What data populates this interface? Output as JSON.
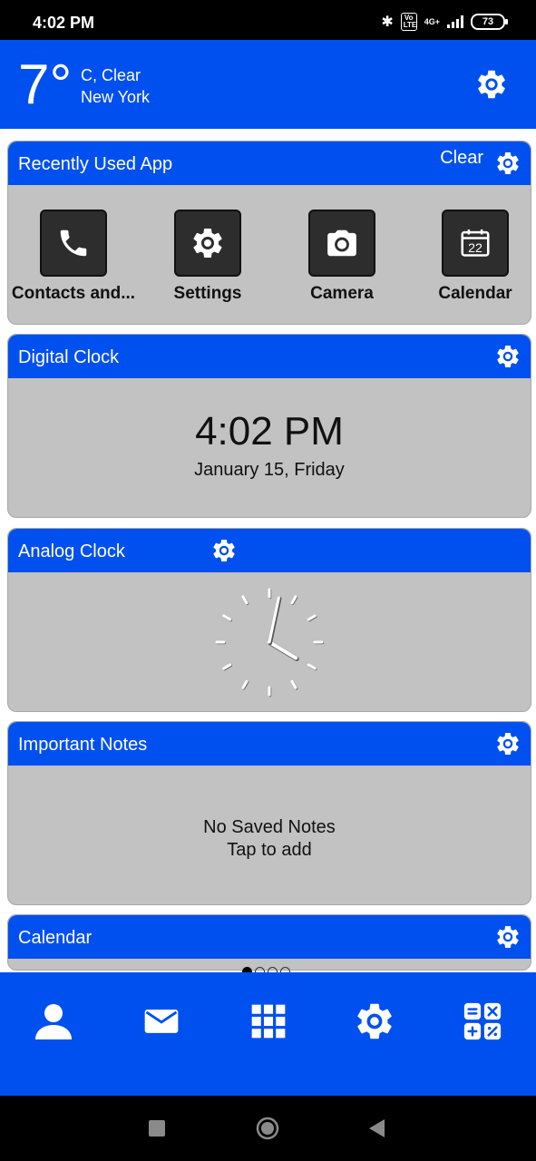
{
  "status_bar": {
    "time": "4:02 PM",
    "network": "4G+",
    "volte": "Vo LTE",
    "battery": "73"
  },
  "weather": {
    "temperature": "7°",
    "condition": "C, Clear",
    "city": "New York",
    "icon": "gear-icon"
  },
  "recent_apps": {
    "title": "Recently Used App",
    "clear_label": "Clear",
    "apps": [
      {
        "label": "Contacts and...",
        "icon": "phone-icon"
      },
      {
        "label": "Settings",
        "icon": "gear-icon"
      },
      {
        "label": "Camera",
        "icon": "camera-icon"
      },
      {
        "label": "Calendar",
        "icon": "calendar-icon",
        "day": "22"
      }
    ]
  },
  "digital_clock": {
    "title": "Digital Clock",
    "time": "4:02 PM",
    "date": "January 15, Friday"
  },
  "analog_clock": {
    "title": "Analog Clock",
    "hour": 4,
    "minute": 2
  },
  "notes": {
    "title": "Important Notes",
    "empty_line1": "No Saved Notes",
    "empty_line2": "Tap to add"
  },
  "calendar": {
    "title": "Calendar"
  },
  "pager": {
    "pages": 4,
    "active": 1
  },
  "dock": [
    {
      "icon": "contact-person-icon"
    },
    {
      "icon": "mail-icon"
    },
    {
      "icon": "app-grid-icon"
    },
    {
      "icon": "settings-gear-icon"
    },
    {
      "icon": "calculator-icon"
    }
  ],
  "colors": {
    "accent": "#0050ef",
    "card_bg": "#c2c2c2",
    "tile": "#2d2d2d"
  }
}
